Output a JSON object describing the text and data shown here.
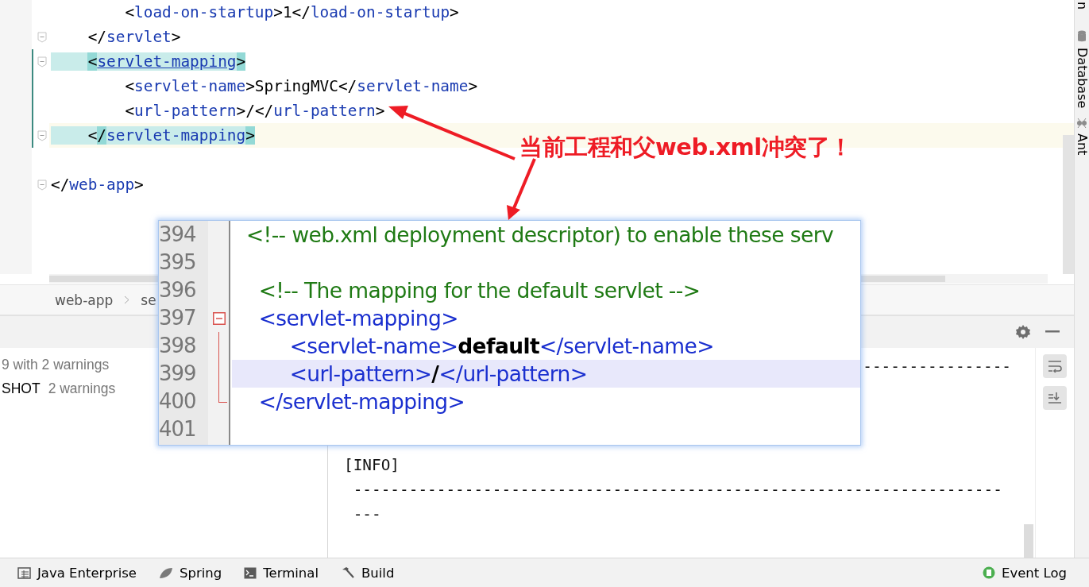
{
  "editor": {
    "lines": [
      {
        "kind": "code",
        "fold": false,
        "matched": false,
        "current": false,
        "tokens": [
          {
            "kind": "punct",
            "text": "        <"
          },
          {
            "kind": "tag",
            "text": "load-on-startup"
          },
          {
            "kind": "punct",
            "text": ">"
          },
          {
            "kind": "value",
            "text": "1"
          },
          {
            "kind": "punct",
            "text": "</"
          },
          {
            "kind": "tag",
            "text": "load-on-startup"
          },
          {
            "kind": "punct",
            "text": ">"
          }
        ]
      },
      {
        "kind": "code",
        "fold": true,
        "matched": false,
        "current": false,
        "tokens": [
          {
            "kind": "punct",
            "text": "    </"
          },
          {
            "kind": "tag",
            "text": "servlet"
          },
          {
            "kind": "punct",
            "text": ">"
          }
        ]
      },
      {
        "kind": "code",
        "fold": true,
        "matched": true,
        "current": false,
        "tokens": [
          {
            "kind": "punct",
            "text": "    <"
          },
          {
            "kind": "link",
            "text": "servlet-mapping"
          },
          {
            "kind": "punct",
            "text": ">"
          }
        ]
      },
      {
        "kind": "code",
        "fold": false,
        "matched": false,
        "current": false,
        "tokens": [
          {
            "kind": "punct",
            "text": "        <"
          },
          {
            "kind": "tag",
            "text": "servlet-name"
          },
          {
            "kind": "punct",
            "text": ">"
          },
          {
            "kind": "value",
            "text": "SpringMVC"
          },
          {
            "kind": "punct",
            "text": "</"
          },
          {
            "kind": "tag",
            "text": "servlet-name"
          },
          {
            "kind": "punct",
            "text": ">"
          }
        ]
      },
      {
        "kind": "code",
        "fold": false,
        "matched": false,
        "current": false,
        "tokens": [
          {
            "kind": "punct",
            "text": "        <"
          },
          {
            "kind": "tag",
            "text": "url-pattern"
          },
          {
            "kind": "punct",
            "text": ">"
          },
          {
            "kind": "value",
            "text": "/"
          },
          {
            "kind": "punct",
            "text": "</"
          },
          {
            "kind": "tag",
            "text": "url-pattern"
          },
          {
            "kind": "punct",
            "text": ">"
          }
        ]
      },
      {
        "kind": "code",
        "fold": true,
        "matched": true,
        "current": true,
        "tokens": [
          {
            "kind": "punct",
            "text": "    </"
          },
          {
            "kind": "tag",
            "text": "servlet-mapping"
          },
          {
            "kind": "punct",
            "text": ">"
          }
        ]
      },
      {
        "kind": "blank"
      },
      {
        "kind": "code",
        "fold": true,
        "matched": false,
        "current": false,
        "tokens": [
          {
            "kind": "punct",
            "text": "</"
          },
          {
            "kind": "tag",
            "text": "web-app"
          },
          {
            "kind": "punct",
            "text": ">"
          }
        ]
      }
    ]
  },
  "side_tabs": [
    "n",
    "Database",
    "Ant"
  ],
  "breadcrumb": [
    "web-app",
    "se"
  ],
  "build_tree": [
    {
      "detail": "9 with 2 warnings"
    },
    {
      "name": "SHOT",
      "detail": "2 warnings"
    }
  ],
  "console": [
    {
      "kind": "tail",
      "text": "----------------"
    },
    {
      "kind": "spacer"
    },
    {
      "kind": "spacer"
    },
    {
      "kind": "spacer"
    },
    {
      "kind": "line",
      "text": "[INFO]"
    },
    {
      "kind": "line",
      "text": " ----------------------------------------------------------------------"
    },
    {
      "kind": "line",
      "text": " ---"
    }
  ],
  "annotation": {
    "text": "当前工程和父web.xml冲突了！"
  },
  "popup": {
    "lines": [
      {
        "number": "394",
        "kind": "plain",
        "current": false,
        "tokens": [
          {
            "kind": "comment",
            "text": "<!-- web.xml deployment descriptor) to enable these serv"
          }
        ]
      },
      {
        "number": "395",
        "kind": "plain",
        "current": false
      },
      {
        "number": "396",
        "kind": "plain",
        "current": false,
        "tokens": [
          {
            "kind": "comment",
            "text": "  <!-- The mapping for the default servlet -->"
          }
        ]
      },
      {
        "number": "397",
        "kind": "fold-start",
        "current": false,
        "tokens": [
          {
            "kind": "tag",
            "text": "  <servlet-mapping>"
          }
        ]
      },
      {
        "number": "398",
        "kind": "plain",
        "current": false,
        "tokens": [
          {
            "kind": "tag",
            "text": "       <servlet-name>"
          },
          {
            "kind": "value",
            "text": "default"
          },
          {
            "kind": "tag",
            "text": "</servlet-name>"
          }
        ]
      },
      {
        "number": "399",
        "kind": "plain",
        "current": true,
        "tokens": [
          {
            "kind": "tag",
            "text": "       <url-pattern>"
          },
          {
            "kind": "value",
            "text": "/"
          },
          {
            "kind": "tag",
            "text": "</url-pattern>"
          }
        ]
      },
      {
        "number": "400",
        "kind": "fold-end",
        "current": false,
        "tokens": [
          {
            "kind": "tag",
            "text": "  </servlet-mapping>"
          }
        ]
      },
      {
        "number": "401",
        "kind": "plain",
        "current": false
      }
    ]
  },
  "toolbar": [
    {
      "label": "Java Enterprise"
    },
    {
      "label": "Spring"
    },
    {
      "label": "Terminal"
    },
    {
      "label": "Build"
    }
  ],
  "event_log": {
    "label": "Event Log"
  }
}
